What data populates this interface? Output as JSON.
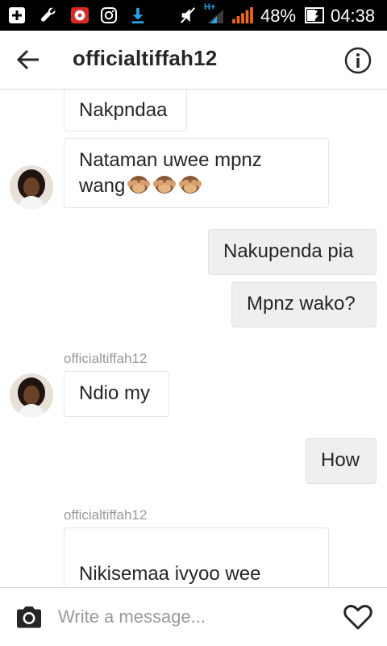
{
  "status_bar": {
    "battery_percent": "48%",
    "time": "04:38",
    "network_label": "H+",
    "icons": [
      "add-box-icon",
      "wrench-icon",
      "music-app-icon",
      "instagram-icon",
      "download-icon",
      "mute-icon",
      "signal-icon",
      "battery-icon"
    ]
  },
  "header": {
    "title": "officialtiffah12",
    "back_icon": "back-arrow-icon",
    "info_icon": "info-icon"
  },
  "messages": [
    {
      "direction": "incoming",
      "text": "Nakpndaa"
    },
    {
      "direction": "incoming",
      "text": "Nataman uwee mpnz\nwang",
      "emojis": [
        "see-no-evil-monkey",
        "see-no-evil-monkey",
        "see-no-evil-monkey"
      ]
    },
    {
      "direction": "outgoing",
      "text": "Nakupenda pia"
    },
    {
      "direction": "outgoing",
      "text": "Mpnz wako?"
    },
    {
      "direction": "incoming",
      "sender": "officialtiffah12",
      "text": "Ndio my"
    },
    {
      "direction": "outgoing",
      "text": "How"
    },
    {
      "direction": "incoming",
      "sender": "officialtiffah12",
      "text": "Nikisemaa ivyoo wee\nunahis vp jmn"
    }
  ],
  "composer": {
    "placeholder": "Write a message...",
    "camera_icon": "camera-icon",
    "heart_icon": "heart-icon"
  },
  "colors": {
    "incoming_bubble": "#ffffff",
    "outgoing_bubble": "#efefef",
    "text": "#262626",
    "muted": "#999999",
    "signal_orange": "#f26b1d",
    "download_blue": "#2aa4e6"
  }
}
